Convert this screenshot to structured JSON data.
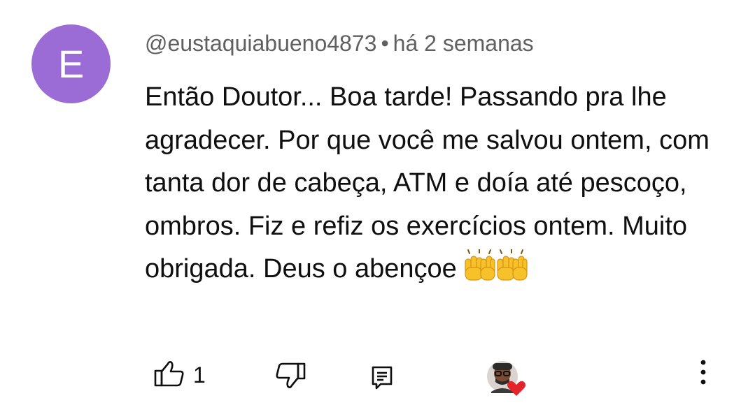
{
  "comment": {
    "avatar_letter": "E",
    "avatar_color": "#9b6bd6",
    "author": "@eustaquiabueno4873",
    "separator": "•",
    "timestamp": "há 2 semanas",
    "text": "Então Doutor... Boa tarde!  Passando pra lhe agradecer. Por que você me salvou ontem, com tanta dor de cabeça, ATM e doía até pescoço, ombros. Fiz e refiz os exercícios ontem. Muito obrigada. Deus o abençoe",
    "emoji": "🙌🙌"
  },
  "actions": {
    "like_icon": "thumbs-up-icon",
    "like_count": "1",
    "dislike_icon": "thumbs-down-icon",
    "reply_icon": "reply-icon",
    "creator_heart_icon": "creator-heart-icon",
    "more_icon": "more-vertical-icon"
  },
  "colors": {
    "heart": "#e3242b",
    "secondary_text": "#606060"
  }
}
